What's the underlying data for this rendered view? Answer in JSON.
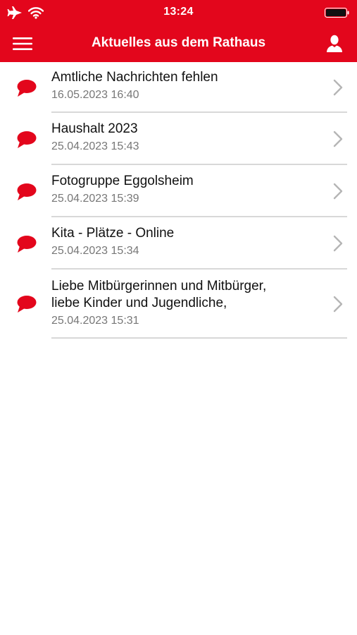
{
  "status_bar": {
    "time": "13:24",
    "icons": [
      "airplane-icon",
      "wifi-icon",
      "battery-icon"
    ]
  },
  "nav": {
    "title": "Aktuelles aus dem Rathaus",
    "menu_icon": "hamburger-menu-icon",
    "user_icon": "user-icon"
  },
  "colors": {
    "brand_red": "#e3061c",
    "title_text": "#111111",
    "date_text": "#777777",
    "divider": "#d8d8d8",
    "chevron": "#b5b5b5"
  },
  "news": [
    {
      "title_lines": [
        "Amtliche Nachrichten fehlen"
      ],
      "date": "16.05.2023 16:40"
    },
    {
      "title_lines": [
        "Haushalt 2023"
      ],
      "date": "25.04.2023 15:43"
    },
    {
      "title_lines": [
        "Fotogruppe Eggolsheim"
      ],
      "date": "25.04.2023 15:39"
    },
    {
      "title_lines": [
        "Kita - Plätze - Online"
      ],
      "date": "25.04.2023 15:34"
    },
    {
      "title_lines": [
        "Liebe Mitbürgerinnen und Mitbürger,",
        "liebe Kinder und Jugendliche,"
      ],
      "date": "25.04.2023 15:31"
    }
  ]
}
